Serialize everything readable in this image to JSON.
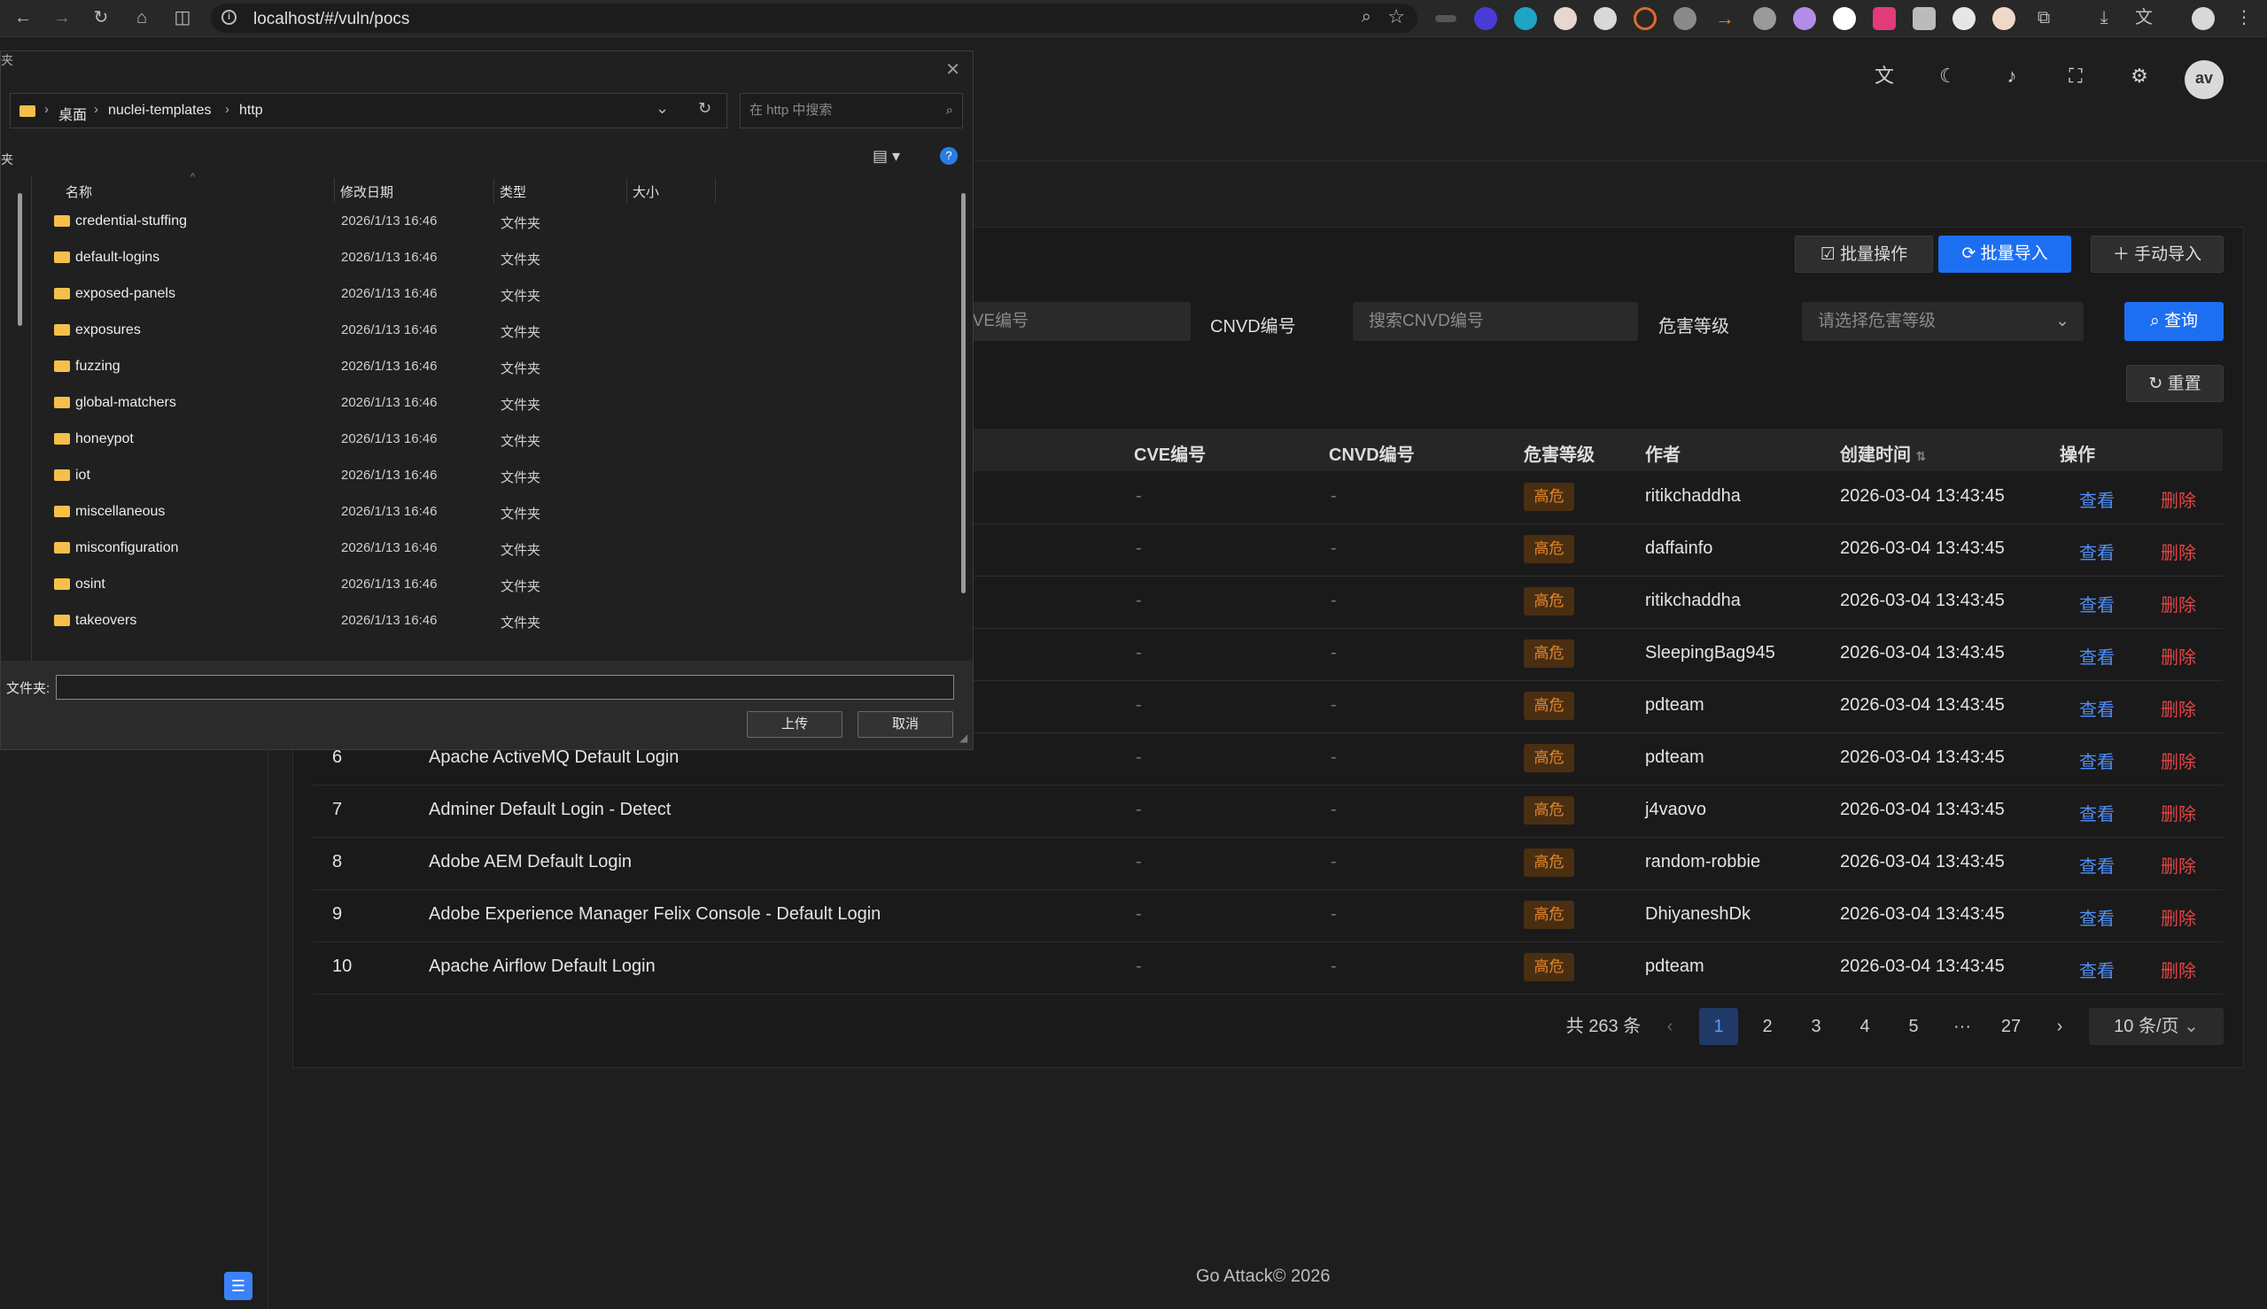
{
  "browser": {
    "url": "localhost/#/vuln/pocs"
  },
  "toolbar": {
    "batch_ops": "批量操作",
    "batch_import": "批量导入",
    "manual_import": "手动导入"
  },
  "filters": {
    "cve_placeholder": "CVE编号",
    "cnvd_label": "CNVD编号",
    "cnvd_placeholder": "搜索CNVD编号",
    "severity_label": "危害等级",
    "severity_placeholder": "请选择危害等级",
    "search": "查询",
    "reset": "重置"
  },
  "table": {
    "headers": {
      "cve": "CVE编号",
      "cnvd": "CNVD编号",
      "severity": "危害等级",
      "author": "作者",
      "created": "创建时间",
      "actions": "操作"
    },
    "view_label": "查看",
    "delete_label": "删除",
    "rows": [
      {
        "idx": "",
        "name": "",
        "cve": "-",
        "cnvd": "-",
        "severity": "高危",
        "author": "ritikchaddha",
        "created": "2026-03-04 13:43:45"
      },
      {
        "idx": "",
        "name": "",
        "cve": "-",
        "cnvd": "-",
        "severity": "高危",
        "author": "daffainfo",
        "created": "2026-03-04 13:43:45"
      },
      {
        "idx": "",
        "name": "",
        "cve": "-",
        "cnvd": "-",
        "severity": "高危",
        "author": "ritikchaddha",
        "created": "2026-03-04 13:43:45"
      },
      {
        "idx": "",
        "name": "",
        "cve": "-",
        "cnvd": "-",
        "severity": "高危",
        "author": "SleepingBag945",
        "created": "2026-03-04 13:43:45"
      },
      {
        "idx": "",
        "name": "",
        "cve": "-",
        "cnvd": "-",
        "severity": "高危",
        "author": "pdteam",
        "created": "2026-03-04 13:43:45"
      },
      {
        "idx": "6",
        "name": "Apache ActiveMQ Default Login",
        "cve": "-",
        "cnvd": "-",
        "severity": "高危",
        "author": "pdteam",
        "created": "2026-03-04 13:43:45"
      },
      {
        "idx": "7",
        "name": "Adminer Default Login - Detect",
        "cve": "-",
        "cnvd": "-",
        "severity": "高危",
        "author": "j4vaovo",
        "created": "2026-03-04 13:43:45"
      },
      {
        "idx": "8",
        "name": "Adobe AEM Default Login",
        "cve": "-",
        "cnvd": "-",
        "severity": "高危",
        "author": "random-robbie",
        "created": "2026-03-04 13:43:45"
      },
      {
        "idx": "9",
        "name": "Adobe Experience Manager Felix Console - Default Login",
        "cve": "-",
        "cnvd": "-",
        "severity": "高危",
        "author": "DhiyaneshDk",
        "created": "2026-03-04 13:43:45"
      },
      {
        "idx": "10",
        "name": "Apache Airflow Default Login",
        "cve": "-",
        "cnvd": "-",
        "severity": "高危",
        "author": "pdteam",
        "created": "2026-03-04 13:43:45"
      }
    ]
  },
  "pagination": {
    "total": "共 263 条",
    "pages": [
      "1",
      "2",
      "3",
      "4",
      "5",
      "···",
      "27"
    ],
    "current": "1",
    "page_size": "10 条/页"
  },
  "footer": "Go Attack© 2026",
  "dialog": {
    "breadcrumb": [
      "桌面",
      "nuclei-templates",
      "http"
    ],
    "search_placeholder": "在 http 中搜索",
    "left_header": "夹",
    "columns": {
      "name": "名称",
      "date": "修改日期",
      "type": "类型",
      "size": "大小"
    },
    "files": [
      {
        "name": "credential-stuffing",
        "date": "2026/1/13 16:46",
        "type": "文件夹"
      },
      {
        "name": "default-logins",
        "date": "2026/1/13 16:46",
        "type": "文件夹"
      },
      {
        "name": "exposed-panels",
        "date": "2026/1/13 16:46",
        "type": "文件夹"
      },
      {
        "name": "exposures",
        "date": "2026/1/13 16:46",
        "type": "文件夹"
      },
      {
        "name": "fuzzing",
        "date": "2026/1/13 16:46",
        "type": "文件夹"
      },
      {
        "name": "global-matchers",
        "date": "2026/1/13 16:46",
        "type": "文件夹"
      },
      {
        "name": "honeypot",
        "date": "2026/1/13 16:46",
        "type": "文件夹"
      },
      {
        "name": "iot",
        "date": "2026/1/13 16:46",
        "type": "文件夹"
      },
      {
        "name": "miscellaneous",
        "date": "2026/1/13 16:46",
        "type": "文件夹"
      },
      {
        "name": "misconfiguration",
        "date": "2026/1/13 16:46",
        "type": "文件夹"
      },
      {
        "name": "osint",
        "date": "2026/1/13 16:46",
        "type": "文件夹"
      },
      {
        "name": "takeovers",
        "date": "2026/1/13 16:46",
        "type": "文件夹"
      }
    ],
    "folder_label": "文件夹:",
    "folder_value": "",
    "upload": "上传",
    "cancel": "取消"
  },
  "colors": {
    "accent": "#1d6ff2",
    "danger": "#e04545",
    "severity_high": "#e3872b"
  }
}
